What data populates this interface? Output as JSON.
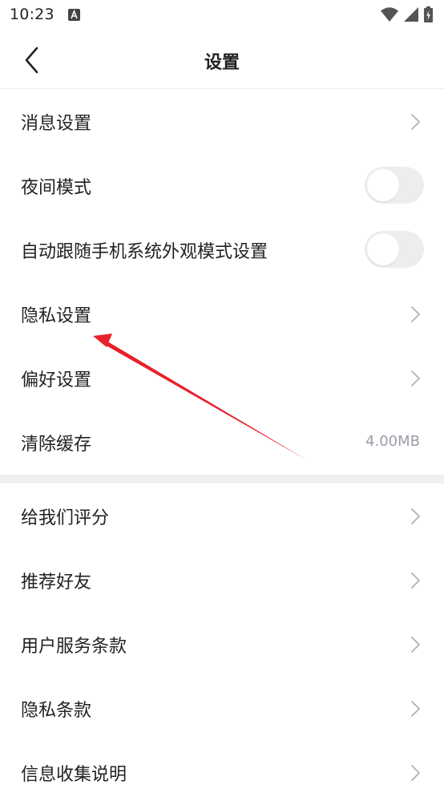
{
  "status_bar": {
    "time": "10:23",
    "icons": [
      "app-notification-icon",
      "wifi-icon",
      "signal-icon",
      "battery-icon"
    ]
  },
  "header": {
    "title": "设置",
    "back_icon": "back-chevron-icon"
  },
  "section1": {
    "items": [
      {
        "label": "消息设置",
        "type": "link"
      },
      {
        "label": "夜间模式",
        "type": "toggle",
        "on": false
      },
      {
        "label": "自动跟随手机系统外观模式设置",
        "type": "toggle",
        "on": false
      },
      {
        "label": "隐私设置",
        "type": "link"
      },
      {
        "label": "偏好设置",
        "type": "link"
      },
      {
        "label": "清除缓存",
        "type": "value",
        "value": "4.00MB"
      }
    ]
  },
  "section2": {
    "items": [
      {
        "label": "给我们评分",
        "type": "link"
      },
      {
        "label": "推荐好友",
        "type": "link"
      },
      {
        "label": "用户服务条款",
        "type": "link"
      },
      {
        "label": "隐私条款",
        "type": "link"
      },
      {
        "label": "信息收集说明",
        "type": "link"
      }
    ]
  },
  "colors": {
    "text": "#222222",
    "secondary_text": "#9a9ba6",
    "chevron": "#b0b1b9",
    "toggle_off": "#ededf0",
    "divider": "#f0f0f3",
    "annotation_arrow": "#e8202a"
  }
}
